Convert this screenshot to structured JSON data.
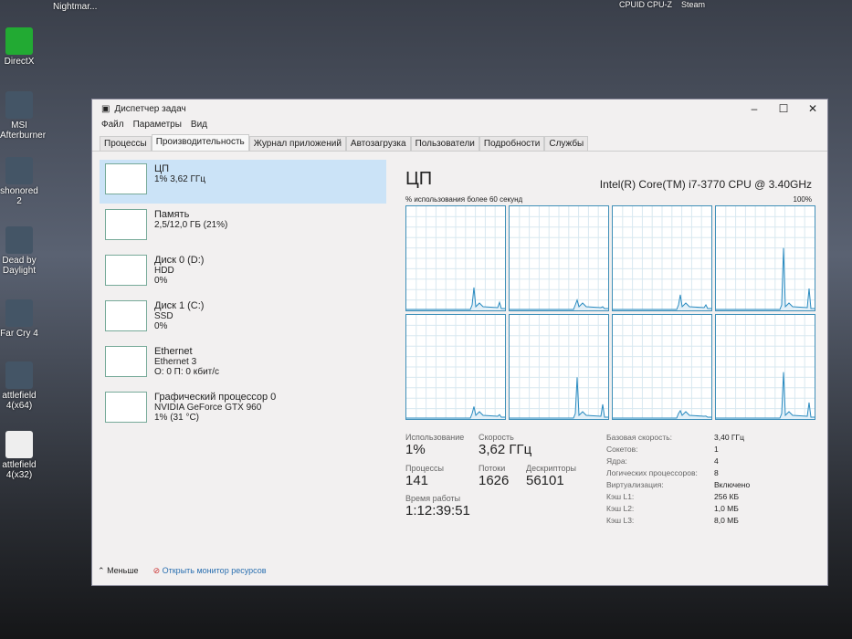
{
  "desktop": {
    "icons": [
      "Nightmar...",
      "DirectX",
      "MSI Afterburner",
      "shonored 2",
      "Dead by Daylight",
      "Far Cry 4",
      "attlefield 4(x64)",
      "attlefield 4(x32)"
    ],
    "top_icons": [
      "CPUID CPU-Z",
      "Steam"
    ]
  },
  "window": {
    "title": "Диспетчер задач",
    "menu": [
      "Файл",
      "Параметры",
      "Вид"
    ],
    "tabs": [
      "Процессы",
      "Производительность",
      "Журнал приложений",
      "Автозагрузка",
      "Пользователи",
      "Подробности",
      "Службы"
    ],
    "active_tab": 1
  },
  "sidebar": [
    {
      "name": "ЦП",
      "line1": "1% 3,62 ГГц",
      "line2": ""
    },
    {
      "name": "Память",
      "line1": "2,5/12,0 ГБ (21%)",
      "line2": ""
    },
    {
      "name": "Диск 0 (D:)",
      "line1": "HDD",
      "line2": "0%"
    },
    {
      "name": "Диск 1 (C:)",
      "line1": "SSD",
      "line2": "0%"
    },
    {
      "name": "Ethernet",
      "line1": "Ethernet 3",
      "line2": "О: 0 П: 0 кбит/с"
    },
    {
      "name": "Графический процессор 0",
      "line1": "NVIDIA GeForce GTX 960",
      "line2": "1% (31 °C)"
    }
  ],
  "main": {
    "title": "ЦП",
    "model": "Intel(R) Core(TM) i7-3770 CPU @ 3.40GHz",
    "graph_label": "% использования более 60 секунд",
    "graph_max": "100%",
    "stats": {
      "usage_label": "Использование",
      "usage": "1%",
      "speed_label": "Скорость",
      "speed": "3,62 ГГц",
      "proc_label": "Процессы",
      "proc": "141",
      "threads_label": "Потоки",
      "threads": "1626",
      "handles_label": "Дескрипторы",
      "handles": "56101",
      "uptime_label": "Время работы",
      "uptime": "1:12:39:51"
    },
    "specs": [
      [
        "Базовая скорость:",
        "3,40 ГГц"
      ],
      [
        "Сокетов:",
        "1"
      ],
      [
        "Ядра:",
        "4"
      ],
      [
        "Логических процессоров:",
        "8"
      ],
      [
        "Виртуализация:",
        "Включено"
      ],
      [
        "Кэш L1:",
        "256 КБ"
      ],
      [
        "Кэш L2:",
        "1,0 МБ"
      ],
      [
        "Кэш L3:",
        "8,0 МБ"
      ]
    ],
    "core_peaks": [
      22,
      10,
      15,
      60,
      12,
      40,
      8,
      45
    ]
  },
  "footer": {
    "less": "Меньше",
    "monitor": "Открыть монитор ресурсов"
  }
}
